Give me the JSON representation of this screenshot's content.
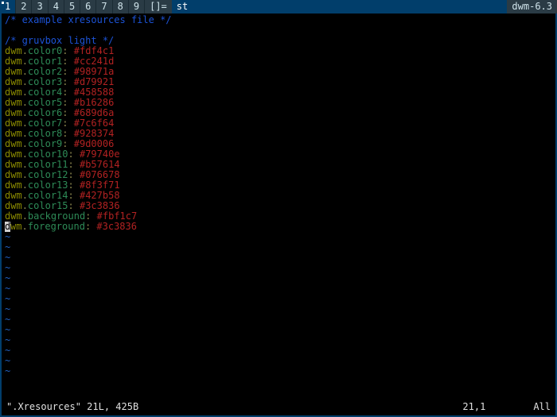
{
  "bar": {
    "tags": [
      "1",
      "2",
      "3",
      "4",
      "5",
      "6",
      "7",
      "8",
      "9"
    ],
    "selected_tag_index": 0,
    "layout_symbol": "[]=",
    "title": "st",
    "status": "dwm-6.3"
  },
  "editor": {
    "comment1": "/* example xresources file */",
    "comment2": "/* gruvbox light */",
    "prefix": "dwm",
    "lines": [
      {
        "key": "color0",
        "value": "#fdf4c1"
      },
      {
        "key": "color1",
        "value": "#cc241d"
      },
      {
        "key": "color2",
        "value": "#98971a"
      },
      {
        "key": "color3",
        "value": "#d79921"
      },
      {
        "key": "color4",
        "value": "#458588"
      },
      {
        "key": "color5",
        "value": "#b16286"
      },
      {
        "key": "color6",
        "value": "#689d6a"
      },
      {
        "key": "color7",
        "value": "#7c6f64"
      },
      {
        "key": "color8",
        "value": "#928374"
      },
      {
        "key": "color9",
        "value": "#9d0006"
      },
      {
        "key": "color10",
        "value": "#79740e"
      },
      {
        "key": "color11",
        "value": "#b57614"
      },
      {
        "key": "color12",
        "value": "#076678"
      },
      {
        "key": "color13",
        "value": "#8f3f71"
      },
      {
        "key": "color14",
        "value": "#427b58"
      },
      {
        "key": "color15",
        "value": "#3c3836"
      },
      {
        "key": "background",
        "value": "#fbf1c7"
      },
      {
        "key": "foreground",
        "value": "#3c3836"
      }
    ],
    "tilde_rows": 14,
    "status": {
      "file": "\".Xresources\" 21L, 425B",
      "pos": "21,1",
      "scroll": "All"
    },
    "cursor_line_key": "foreground"
  }
}
